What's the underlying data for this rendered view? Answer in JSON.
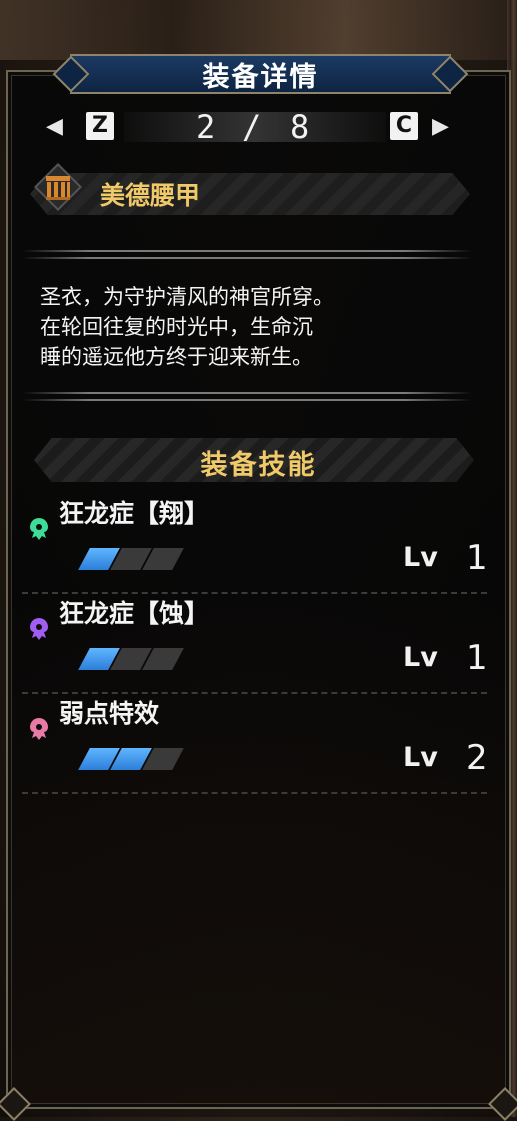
{
  "panel": {
    "title": "装备详情",
    "pager": {
      "prev_key": "Z",
      "next_key": "C",
      "current": "2",
      "separator": "/",
      "total": "8"
    }
  },
  "armor": {
    "name": "美德腰甲",
    "icon": "waist-armor-icon",
    "description": [
      "圣衣，为守护清风的神官所穿。",
      "在轮回往复的时光中，生命沉",
      "睡的遥远他方终于迎来新生。"
    ]
  },
  "skills": {
    "title": "装备技能",
    "level_label": "Lv",
    "items": [
      {
        "name": "狂龙症【翔】",
        "level": "1",
        "max_level": 3,
        "icon": "skill-icon",
        "color": "#3ddc97"
      },
      {
        "name": "狂龙症【蚀】",
        "level": "1",
        "max_level": 3,
        "icon": "skill-icon",
        "color": "#a15cf0"
      },
      {
        "name": "弱点特效",
        "level": "2",
        "max_level": 3,
        "icon": "skill-icon",
        "color": "#e87aa8"
      }
    ]
  },
  "colors": {
    "accent_gold": "#f0c968",
    "title_bar_blue": "#1b3a63",
    "level_bar_blue": "#3a96f0"
  }
}
